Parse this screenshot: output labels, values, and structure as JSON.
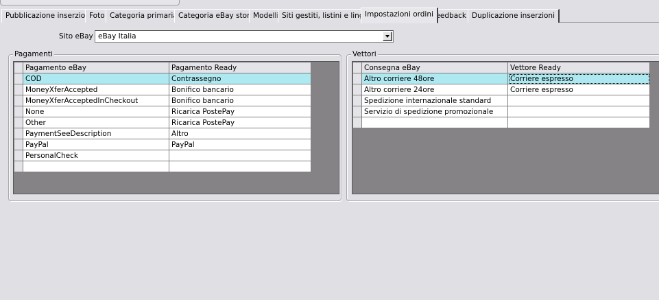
{
  "tabs": [
    {
      "label": "Pubblicazione inserzioni"
    },
    {
      "label": "Foto"
    },
    {
      "label": "Categoria primaria"
    },
    {
      "label": "Categoria eBay store"
    },
    {
      "label": "Modelli"
    },
    {
      "label": "Siti gestiti, listini e lingue"
    },
    {
      "label": "Impostazioni ordini"
    },
    {
      "label": "Feedback"
    },
    {
      "label": "Duplicazione inserzioni"
    }
  ],
  "active_tab": "Impostazioni ordini",
  "site": {
    "label": "Sito eBay :",
    "value": "eBay Italia"
  },
  "payments": {
    "title": "Pagamenti",
    "columns": [
      "Pagamento eBay",
      "Pagamento Ready"
    ],
    "rows": [
      [
        "COD",
        "Contrassegno"
      ],
      [
        "MoneyXferAccepted",
        "Bonifico bancario"
      ],
      [
        "MoneyXferAcceptedInCheckout",
        "Bonifico bancario"
      ],
      [
        "None",
        "Ricarica PostePay"
      ],
      [
        "Other",
        "Ricarica PostePay"
      ],
      [
        "PaymentSeeDescription",
        "Altro"
      ],
      [
        "PayPal",
        "PayPal"
      ],
      [
        "PersonalCheck",
        ""
      ]
    ]
  },
  "carriers": {
    "title": "Vettori",
    "columns": [
      "Consegna eBay",
      "Vettore Ready"
    ],
    "rows": [
      [
        "Altro corriere 48ore",
        "Corriere espresso"
      ],
      [
        "Altro corriere 24ore",
        "Corriere espresso"
      ],
      [
        "Spedizione internazionale standard",
        ""
      ],
      [
        "Servizio di spedizione promozionale",
        ""
      ]
    ]
  },
  "colors": {
    "selected_row": "#aee9f2",
    "grid_background": "#858386",
    "window": "#e0dfe3"
  }
}
